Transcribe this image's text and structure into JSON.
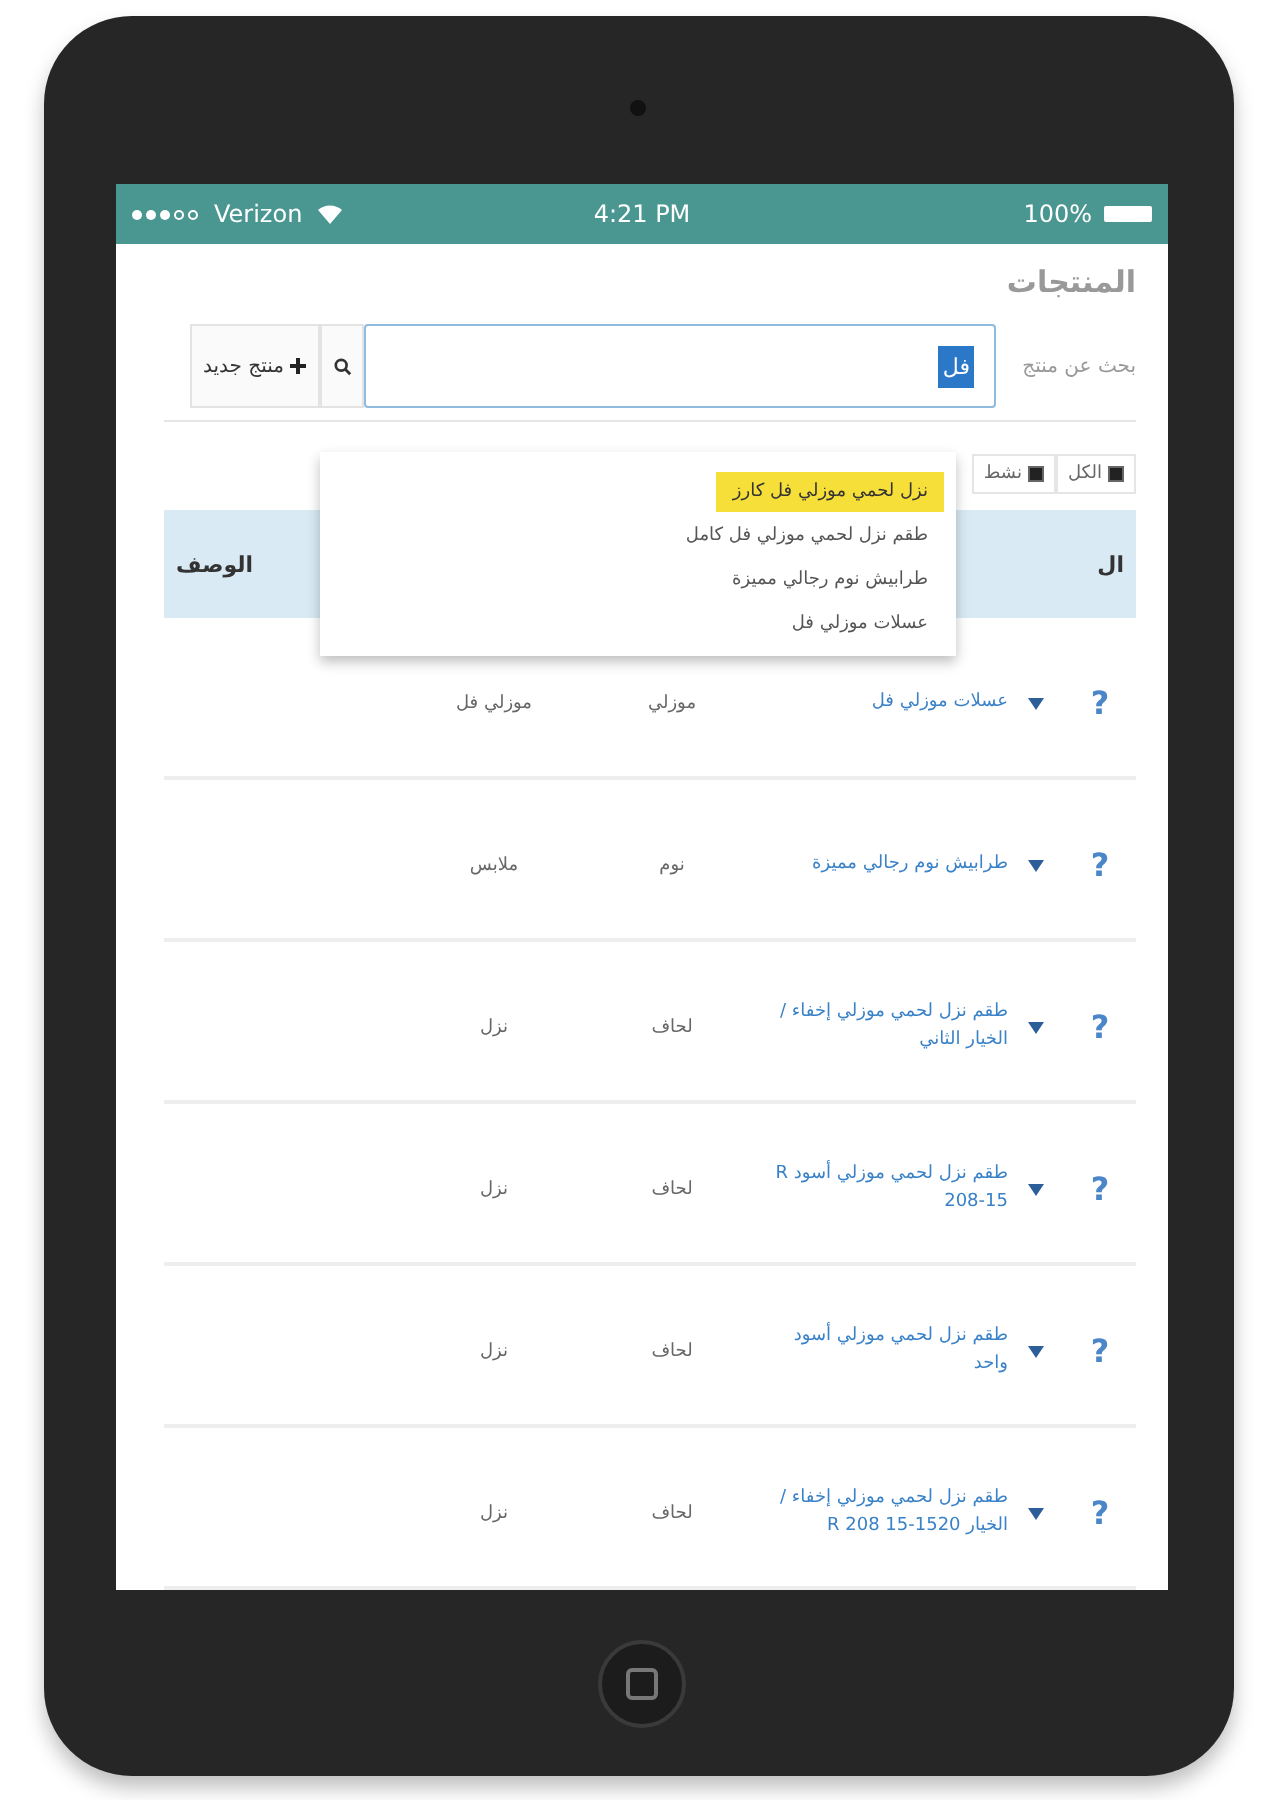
{
  "status_bar": {
    "carrier": "Verizon",
    "time": "4:21 PM",
    "battery": "100%"
  },
  "page": {
    "title": "المنتجات"
  },
  "search": {
    "label": "بحث عن منتج",
    "value": "فل",
    "add_button": "منتج جديد"
  },
  "suggestions": [
    {
      "label": "نزل لحمي موزلي فل كارز",
      "selected": true
    },
    {
      "label": "طقم نزل لحمي موزلي فل كامل",
      "selected": false
    },
    {
      "label": "طرابيش نوم رجالي مميزة",
      "selected": false
    },
    {
      "label": "عسلات موزلي فل",
      "selected": false
    }
  ],
  "filters": [
    {
      "label": "الكل",
      "checked": true
    },
    {
      "label": "نشط",
      "checked": true
    }
  ],
  "table": {
    "columns": [
      "ال",
      "الوصف"
    ],
    "rows": [
      {
        "help": "?",
        "name": "عسلات موزلي فل",
        "column_2": "موزلي",
        "column_3": "موزلي فل"
      },
      {
        "help": "?",
        "name": "طرابيش نوم رجالي مميزة",
        "column_2": "نوم",
        "column_3": "ملابس"
      },
      {
        "help": "?",
        "name": "طقم نزل لحمي موزلي إخفاء / الخيار الثاني",
        "column_2": "لحاف",
        "column_3": "نزل"
      },
      {
        "help": "?",
        "name": "طقم نزل لحمي موزلي أسود R 208-15",
        "column_2": "لحاف",
        "column_3": "نزل"
      },
      {
        "help": "?",
        "name": "طقم نزل لحمي موزلي أسود واحد",
        "column_2": "لحاف",
        "column_3": "نزل"
      },
      {
        "help": "?",
        "name": "طقم نزل لحمي موزلي إخفاء / الخيار 1520-15 R 208",
        "column_2": "لحاف",
        "column_3": "نزل"
      }
    ]
  }
}
